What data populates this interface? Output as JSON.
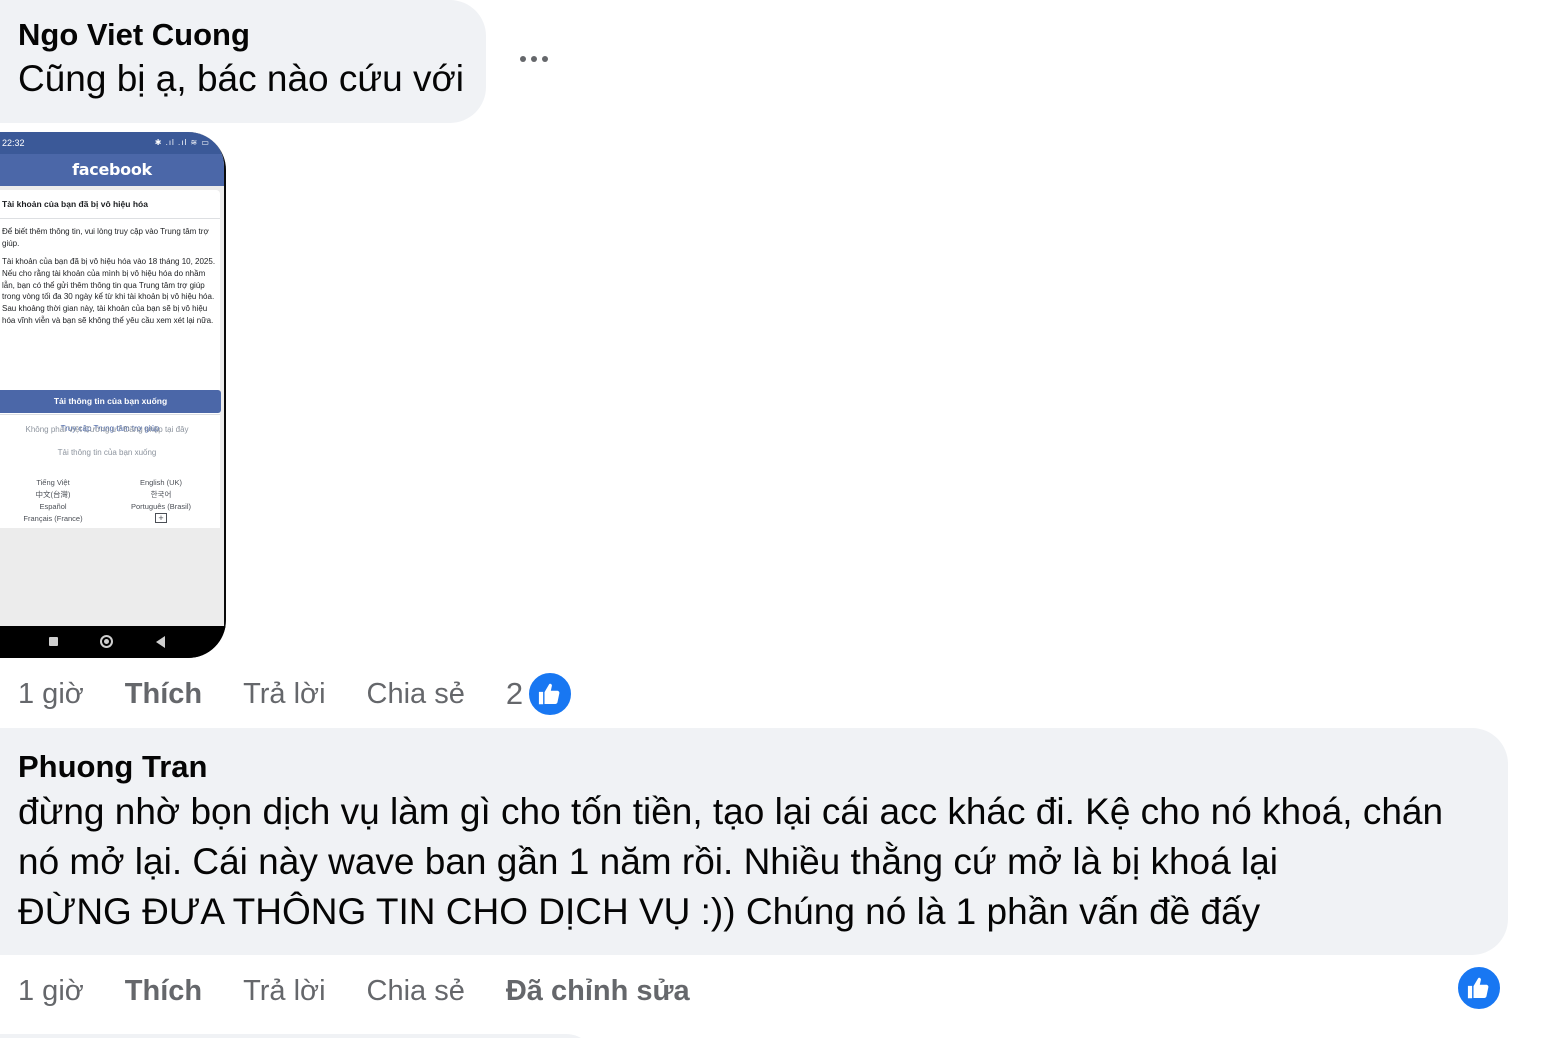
{
  "comments": [
    {
      "author": "Ngo Viet Cuong",
      "text": "Cũng bị ạ, bác nào cứu với",
      "time": "1 giờ",
      "like_label": "Thích",
      "reply_label": "Trả lời",
      "share_label": "Chia sẻ",
      "reaction_count": "2"
    },
    {
      "author": "Phuong Tran",
      "lines": [
        "đừng nhờ bọn dịch vụ làm gì cho tốn tiền, tạo lại cái acc khác đi. Kệ cho nó khoá, chán",
        "nó mở lại. Cái này wave ban gần 1 năm rồi. Nhiều thằng cứ mở là bị khoá lại",
        "ĐỪNG ĐƯA THÔNG TIN CHO DỊCH VỤ :)) Chúng nó là 1 phần vấn đề đấy"
      ],
      "time": "1 giờ",
      "like_label": "Thích",
      "reply_label": "Trả lời",
      "share_label": "Chia sẻ",
      "edited_label": "Đã chỉnh sửa"
    }
  ],
  "attachment": {
    "status_time": "22:32",
    "status_icons": "✱ .ıl .ıl ≋ ▭",
    "brand": "facebook",
    "card_title": "Tài khoản của bạn đã bị vô hiệu hóa",
    "para1": "Để biết thêm thông tin, vui lòng truy cập vào Trung tâm trợ giúp.",
    "para2": "Tài khoản của bạn đã bị vô hiệu hóa vào 18 tháng 10, 2025. Nếu cho rằng tài khoản của mình bị vô hiệu hóa do nhầm lẫn, bạn có thể gửi thêm thông tin qua Trung tâm trợ giúp trong vòng tối đa 30 ngày kể từ khi tài khoản bị vô hiệu hóa. Sau khoảng thời gian này, tài khoản của bạn sẽ bị vô hiệu hóa vĩnh viễn và bạn sẽ không thể yêu cầu xem xét lại nữa.",
    "help_link": "Truy cập Trung tâm trợ giúp",
    "download_button": "Tải thông tin của bạn xuống",
    "not_you": "Không phải Việt Cường ư? Đăng nhập tại đây",
    "download_link": "Tải thông tin của bạn xuống",
    "languages_left": [
      "Tiếng Việt",
      "中文(台灣)",
      "Español",
      "Français (France)"
    ],
    "languages_right": [
      "English (UK)",
      "한국어",
      "Português (Brasil)"
    ],
    "more_languages": "+"
  },
  "colors": {
    "bubble": "#f0f2f5",
    "secondary_text": "#65676b",
    "like_blue": "#1877f2",
    "fb_blue": "#4b67a8"
  },
  "icons": {
    "more": "more-options-icon",
    "like": "thumbs-up-icon"
  }
}
